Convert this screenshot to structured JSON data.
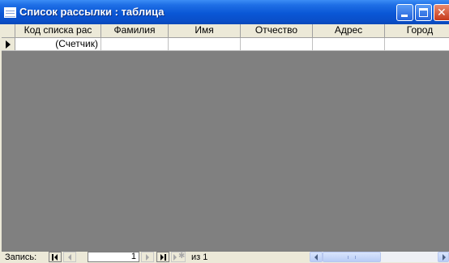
{
  "window": {
    "title": "Список рассылки : таблица"
  },
  "table": {
    "columns": [
      {
        "label": "Код списка рас"
      },
      {
        "label": "Фамилия"
      },
      {
        "label": "Имя"
      },
      {
        "label": "Отчество"
      },
      {
        "label": "Адрес"
      },
      {
        "label": "Город"
      }
    ],
    "new_row": {
      "counter_text": "(Счетчик)"
    }
  },
  "status": {
    "record_label": "Запись:",
    "current_record": "1",
    "of_label": "из 1"
  },
  "colors": {
    "titlebar": "#0a57d6",
    "grid_background": "#808080",
    "chrome": "#ece9d8"
  },
  "icons": [
    "table-icon",
    "minimize-icon",
    "maximize-icon",
    "close-icon",
    "first-record-icon",
    "prev-record-icon",
    "next-record-icon",
    "last-record-icon",
    "new-record-icon",
    "row-selector-arrow-icon"
  ]
}
